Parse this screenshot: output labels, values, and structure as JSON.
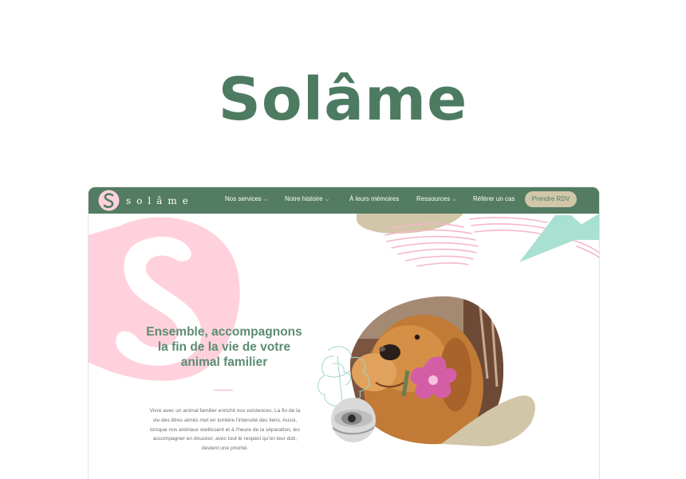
{
  "brand": {
    "name": "Solâme",
    "logo_text": "solâme",
    "colors": {
      "green": "#537c62",
      "title_green": "#4d7b61",
      "pink": "#ffd1dc",
      "sand": "#d2c6a8",
      "mint": "#a8e0d2"
    }
  },
  "nav": {
    "items": [
      {
        "label": "Nos services",
        "dropdown": true
      },
      {
        "label": "Notre histoire",
        "dropdown": true
      },
      {
        "label": "À leurs mémoires",
        "dropdown": false
      },
      {
        "label": "Ressources",
        "dropdown": true
      },
      {
        "label": "Référer un cas",
        "dropdown": false
      }
    ],
    "cta_label": "Prendre RDV"
  },
  "hero": {
    "heading": "Ensemble, accompagnons la fin de la vie de votre animal familier",
    "paragraph": "Vivre avec un animal familier enrichit nos existences. La fin de la vie des êtres aimés met en lumière l'intensité des liens. Aussi, lorsque nos animaux vieillissent et à l'heure de la séparation, les accompagner en douceur, avec tout le respect qu'on leur doit, devient une priorité."
  },
  "icons": {
    "logo": "s-monogram-icon",
    "dropdown": "chevron-down-icon"
  }
}
